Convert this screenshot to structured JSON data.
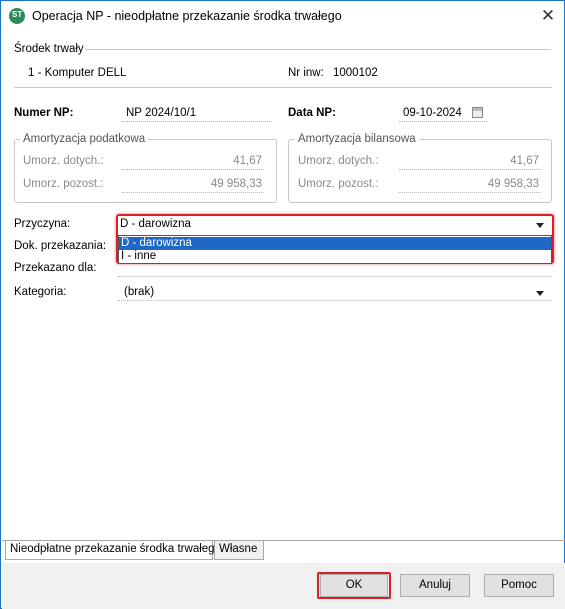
{
  "window": {
    "title": "Operacja NP - nieodpłatne przekazanie środka trwałego",
    "close_glyph": "✕"
  },
  "asset": {
    "section_label": "Środek trwały",
    "name": "1 - Komputer DELL",
    "inv_label": "Nr inw:",
    "inv_value": "1000102"
  },
  "document": {
    "number_label": "Numer NP:",
    "number_value": "NP 2024/10/1",
    "date_label": "Data NP:",
    "date_value": "09-10-2024"
  },
  "tax_amortization": {
    "title": "Amortyzacja podatkowa",
    "row1_label": "Umorz. dotych.:",
    "row1_value": "41,67",
    "row2_label": "Umorz. pozost.:",
    "row2_value": "49 958,33"
  },
  "balance_amortization": {
    "title": "Amortyzacja bilansowa",
    "row1_label": "Umorz. dotych.:",
    "row1_value": "41,67",
    "row2_label": "Umorz. pozost.:",
    "row2_value": "49 958,33"
  },
  "form": {
    "reason_label": "Przyczyna:",
    "reason_value": "D - darowizna",
    "reason_options": [
      "D - darowizna",
      "I - inne"
    ],
    "doc_label": "Dok. przekazania:",
    "recipient_label": "Przekazano dla:",
    "category_label": "Kategoria:",
    "category_value": "(brak)"
  },
  "tabs": [
    "Nieodpłatne przekazanie środka trwałego",
    "Własne"
  ],
  "buttons": {
    "ok": "OK",
    "cancel": "Anuluj",
    "help": "Pomoc"
  },
  "colors": {
    "accent_border": "#1a73c7",
    "highlight_red": "#d9202a",
    "selection_blue": "#1f68c7"
  },
  "icons": [
    "app-icon",
    "close-icon",
    "calendar-icon",
    "chevron-down-icon"
  ]
}
